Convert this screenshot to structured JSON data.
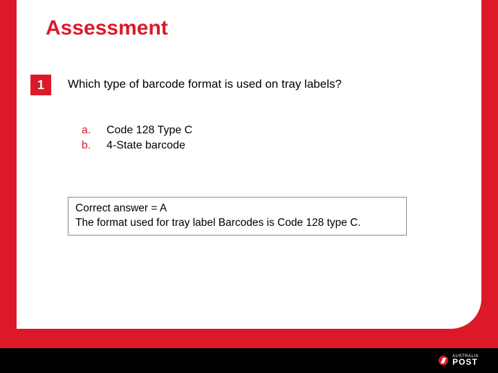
{
  "title": "Assessment",
  "question": {
    "number": "1",
    "text": "Which type of barcode format is used on tray labels?",
    "options": [
      {
        "letter": "a.",
        "text": "Code 128 Type C"
      },
      {
        "letter": "b.",
        "text": "4-State barcode"
      }
    ],
    "answer_line1": "Correct answer = A",
    "answer_line2": "The format used for tray label Barcodes is Code 128 type C."
  },
  "brand": {
    "top": "AUSTRALIA",
    "bottom": "POST"
  }
}
